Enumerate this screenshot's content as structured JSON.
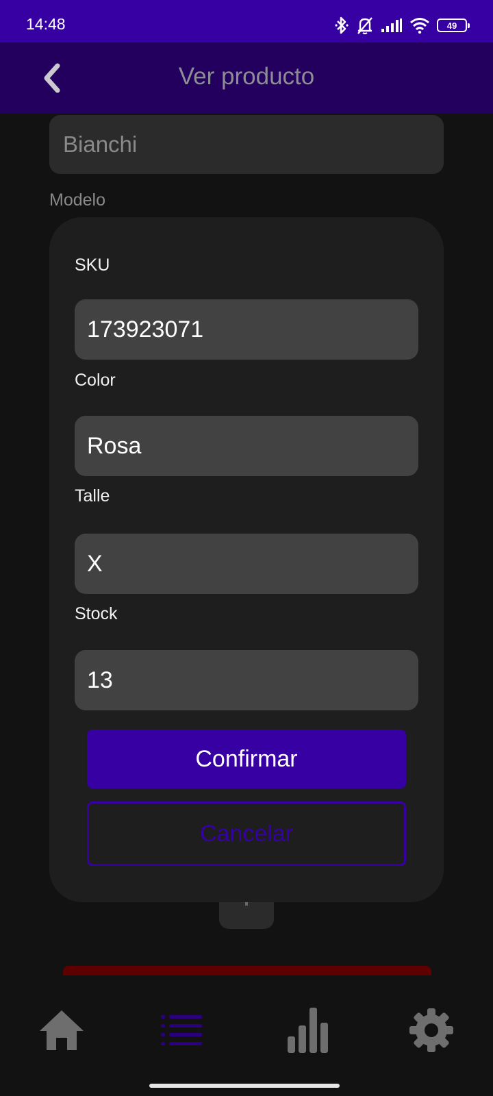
{
  "status_bar": {
    "time": "14:48",
    "battery_level": "49",
    "icons": [
      "bluetooth-icon",
      "bell-off-icon",
      "signal-icon",
      "wifi-icon",
      "battery-icon"
    ]
  },
  "app_bar": {
    "title": "Ver producto",
    "back_icon": "chevron-left-icon"
  },
  "background_form": {
    "brand_value": "Bianchi",
    "model_label": "Modelo"
  },
  "dialog": {
    "fields": [
      {
        "label": "SKU",
        "value": "173923071"
      },
      {
        "label": "Color",
        "value": "Rosa"
      },
      {
        "label": "Talle",
        "value": "X"
      },
      {
        "label": "Stock",
        "value": "13"
      }
    ],
    "confirm_label": "Confirmar",
    "cancel_label": "Cancelar"
  },
  "bottom_nav": {
    "items": [
      {
        "icon": "home-icon",
        "active": false
      },
      {
        "icon": "list-icon",
        "active": true
      },
      {
        "icon": "bar-chart-icon",
        "active": false
      },
      {
        "icon": "gear-icon",
        "active": false
      }
    ]
  },
  "colors": {
    "primary": "#3700a3",
    "app_bar": "#24005e",
    "background": "#121212",
    "dialog": "#1e1e1e",
    "input": "#424242",
    "danger_dark": "#5e0000",
    "nav_icon": "#6e6e6e"
  }
}
